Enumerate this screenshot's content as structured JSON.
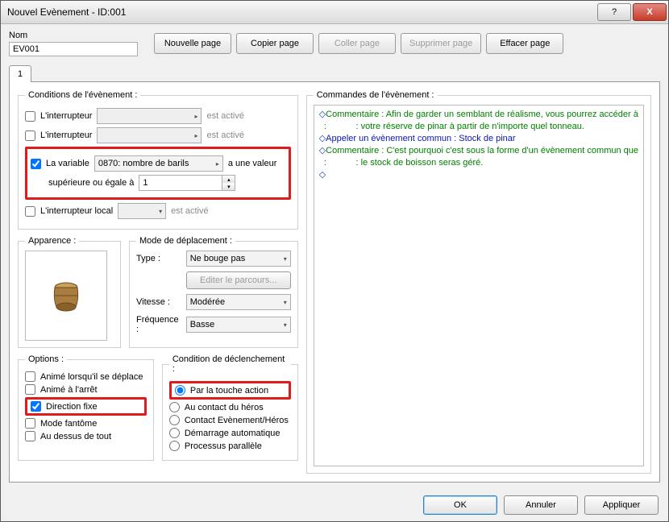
{
  "window": {
    "title": "Nouvel Evènement - ID:001",
    "help": "?",
    "close": "X"
  },
  "name": {
    "label": "Nom",
    "value": "EV001"
  },
  "toolbar": {
    "new_page": "Nouvelle page",
    "copy_page": "Copier page",
    "paste_page": "Coller page",
    "delete_page": "Supprimer page",
    "clear_page": "Effacer page"
  },
  "tab": {
    "label": "1"
  },
  "conditions": {
    "legend": "Conditions de l'évènement :",
    "switch1": {
      "label": "L'interrupteur",
      "value": "",
      "suffix": "est activé"
    },
    "switch2": {
      "label": "L'interrupteur",
      "value": "",
      "suffix": "est activé"
    },
    "variable": {
      "label": "La variable",
      "value": "0870: nombre de barils",
      "suffix": "a une valeur",
      "op": "supérieure ou égale à",
      "num": "1"
    },
    "selfswitch": {
      "label": "L'interrupteur local",
      "value": "",
      "suffix": "est activé"
    }
  },
  "appearance": {
    "legend": "Apparence :"
  },
  "movement": {
    "legend": "Mode de déplacement :",
    "type_label": "Type :",
    "type": "Ne bouge pas",
    "edit_route": "Editer le parcours...",
    "speed_label": "Vitesse :",
    "speed": "Modérée",
    "freq_label": "Fréquence :",
    "freq": "Basse"
  },
  "options": {
    "legend": "Options :",
    "move_anim": "Animé lorsqu'il se déplace",
    "stop_anim": "Animé à l'arrêt",
    "dir_fix": "Direction fixe",
    "through": "Mode fantôme",
    "on_top": "Au dessus de tout"
  },
  "trigger": {
    "legend": "Condition de déclenchement :",
    "action": "Par la touche action",
    "hero_touch": "Au contact du héros",
    "event_touch": "Contact Evènement/Héros",
    "autorun": "Démarrage automatique",
    "parallel": "Processus parallèle"
  },
  "commands": {
    "legend": "Commandes de l'évènement :",
    "lines": [
      {
        "t": "Commentaire : Afin de garder un semblant de réalisme, vous pourrez accéder à",
        "b": true
      },
      {
        "t": " :            : votre réserve de pinar à partir de n'importe quel tonneau.",
        "b": false
      },
      {
        "t": "Appeler un évènement commun : Stock de pinar",
        "b": true,
        "blue": true
      },
      {
        "t": "Commentaire : C'est pourquoi c'est sous la forme d'un évènement commun que",
        "b": true
      },
      {
        "t": " :            : le stock de boisson seras géré.",
        "b": false
      },
      {
        "t": "",
        "b": true
      }
    ]
  },
  "footer": {
    "ok": "OK",
    "cancel": "Annuler",
    "apply": "Appliquer"
  }
}
